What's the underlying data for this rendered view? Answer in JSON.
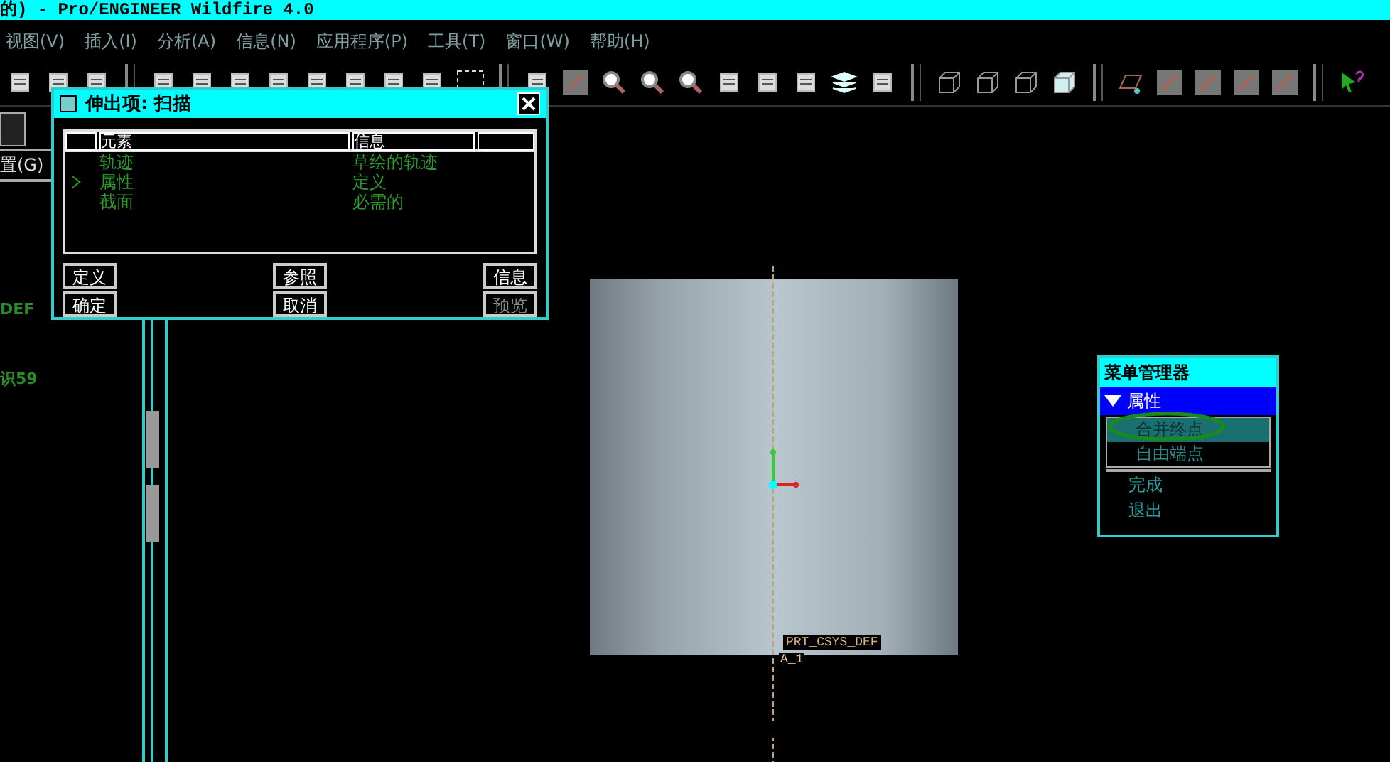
{
  "window": {
    "title": "的) - Pro/ENGINEER Wildfire 4.0"
  },
  "menu_bar": [
    {
      "label": "视图(V)"
    },
    {
      "label": "插入(I)"
    },
    {
      "label": "分析(A)"
    },
    {
      "label": "信息(N)"
    },
    {
      "label": "应用程序(P)"
    },
    {
      "label": "工具(T)"
    },
    {
      "label": "窗口(W)"
    },
    {
      "label": "帮助(H)"
    }
  ],
  "left_panel": {
    "tab_label": "置(G)",
    "tree_labels": [
      "DEF",
      "识59"
    ]
  },
  "dialog": {
    "title": "伸出项: 扫描",
    "columns": [
      "元素",
      "信息"
    ],
    "rows": [
      {
        "element": "轨迹",
        "info": "草绘的轨迹",
        "selected": false
      },
      {
        "element": "属性",
        "info": "定义",
        "selected": true
      },
      {
        "element": "截面",
        "info": "必需的",
        "selected": false
      }
    ],
    "buttons": [
      {
        "label": "定义",
        "disabled": false
      },
      {
        "label": "参照",
        "disabled": false
      },
      {
        "label": "信息",
        "disabled": false
      },
      {
        "label": "确定",
        "disabled": false
      },
      {
        "label": "取消",
        "disabled": false
      },
      {
        "label": "预览",
        "disabled": true
      }
    ]
  },
  "model": {
    "csys_label": "PRT_CSYS_DEF",
    "axis_label": "A_1"
  },
  "menu_manager": {
    "title": "菜单管理器",
    "section": {
      "label": "属性",
      "expanded": true
    },
    "options": [
      {
        "label": "合并终点",
        "selected": true
      },
      {
        "label": "自由端点",
        "selected": false
      }
    ],
    "actions": [
      {
        "label": "完成"
      },
      {
        "label": "退出"
      }
    ]
  }
}
